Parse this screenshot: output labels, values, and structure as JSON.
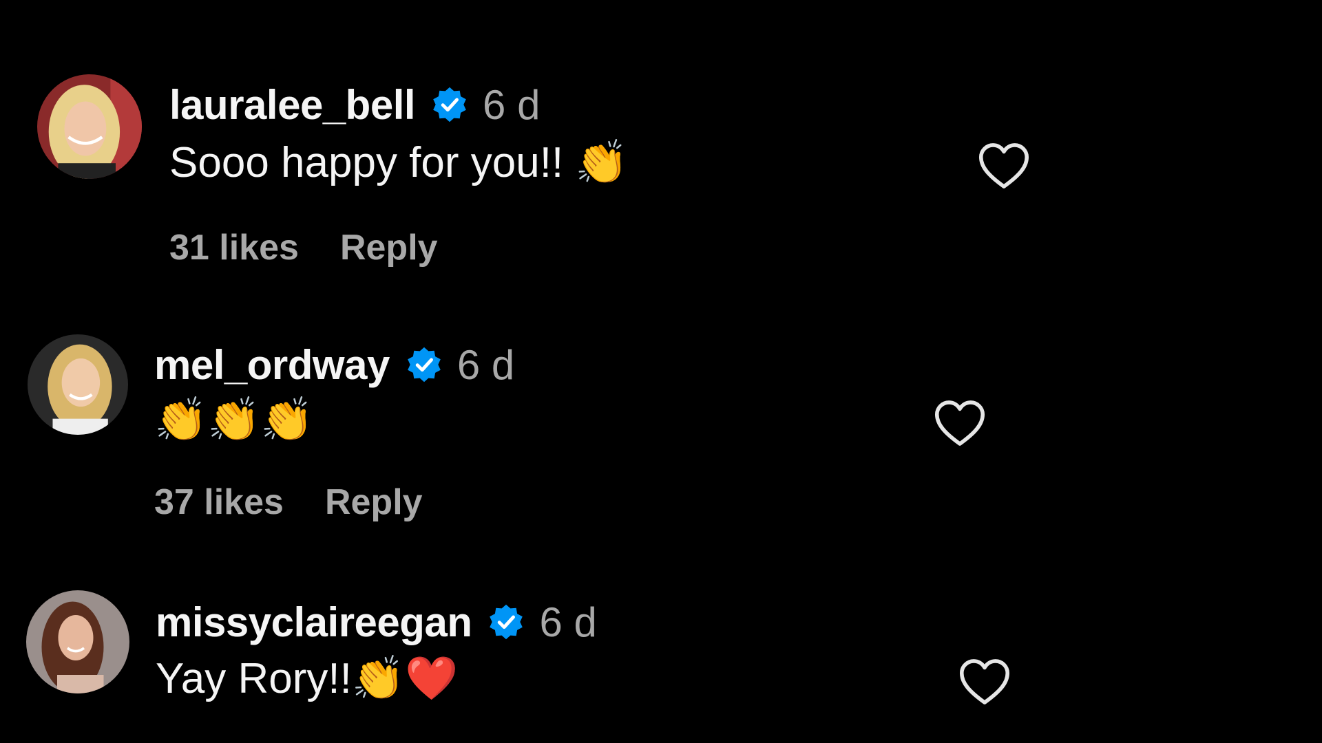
{
  "comments": [
    {
      "username": "lauralee_bell",
      "verified": true,
      "time": "6 d",
      "text": "Sooo happy for you!! 👏",
      "likes": "31 likes",
      "reply_label": "Reply",
      "like_icon": "heart-outline-icon"
    },
    {
      "username": "mel_ordway",
      "verified": true,
      "time": "6 d",
      "text": "👏👏👏",
      "likes": "37 likes",
      "reply_label": "Reply",
      "like_icon": "heart-outline-icon"
    },
    {
      "username": "missyclaireegan",
      "verified": true,
      "time": "6 d",
      "text": "Yay Rory!!👏❤️",
      "likes": "",
      "reply_label": "",
      "like_icon": "heart-outline-icon"
    }
  ],
  "colors": {
    "background": "#000000",
    "primary_text": "#f5f5f5",
    "secondary_text": "#a8a8a8",
    "verified_blue": "#0095f6"
  }
}
